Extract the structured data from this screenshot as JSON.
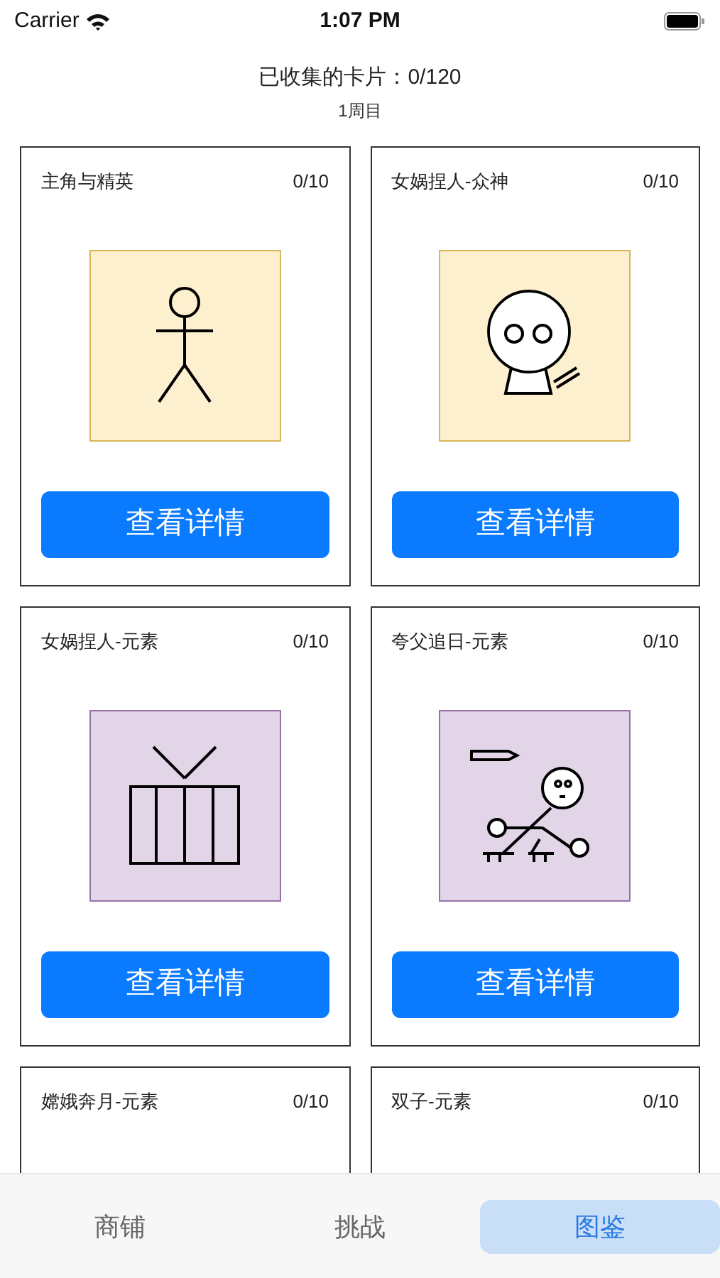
{
  "status_bar": {
    "carrier": "Carrier",
    "time": "1:07 PM"
  },
  "header": {
    "title": "已收集的卡片：0/120",
    "subtitle": "1周目"
  },
  "cards": [
    {
      "title": "主角与精英",
      "count": "0/10",
      "kind": "stickman",
      "color": "#fdf0cf",
      "button": "查看详情"
    },
    {
      "title": "女娲捏人-众神",
      "count": "0/10",
      "kind": "mask",
      "color": "#fdf0cf",
      "button": "查看详情"
    },
    {
      "title": "女娲捏人-元素",
      "count": "0/10",
      "kind": "chest",
      "color": "#e1d5e7",
      "button": "查看详情"
    },
    {
      "title": "夸父追日-元素",
      "count": "0/10",
      "kind": "runner",
      "color": "#e1d5e7",
      "button": "查看详情"
    },
    {
      "title": "嫦娥奔月-元素",
      "count": "0/10"
    },
    {
      "title": "双子-元素",
      "count": "0/10"
    }
  ],
  "tabs": [
    {
      "label": "商铺",
      "selected": false
    },
    {
      "label": "挑战",
      "selected": false
    },
    {
      "label": "图鉴",
      "selected": true
    }
  ]
}
